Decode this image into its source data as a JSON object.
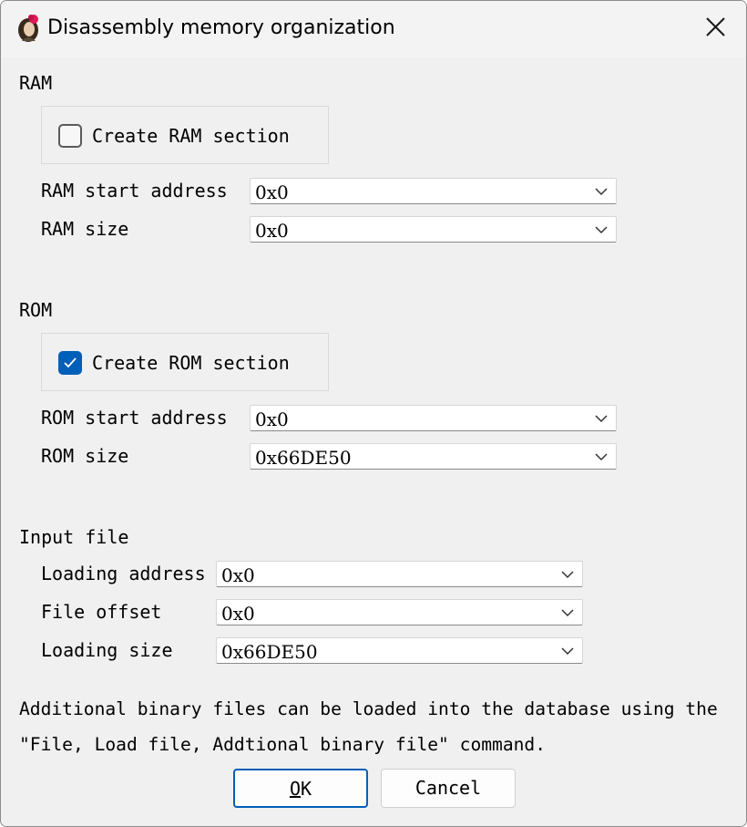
{
  "window": {
    "title": "Disassembly memory organization"
  },
  "ram": {
    "section_label": "RAM",
    "create_label": "Create RAM section",
    "create_checked": false,
    "start_label": "RAM start address",
    "start_value": "0x0",
    "size_label": "RAM size",
    "size_value": "0x0"
  },
  "rom": {
    "section_label": "ROM",
    "create_label": "Create ROM section",
    "create_checked": true,
    "start_label": "ROM start address",
    "start_value": "0x0",
    "size_label": "ROM size",
    "size_value": "0x66DE50"
  },
  "input_file": {
    "section_label": "Input file",
    "loading_address_label": "Loading address",
    "loading_address_value": "0x0",
    "file_offset_label": "File offset",
    "file_offset_value": "0x0",
    "loading_size_label": "Loading size",
    "loading_size_value": "0x66DE50"
  },
  "info": {
    "line1": "Additional binary files can be loaded into the database using the",
    "line2": "\"File, Load file, Addtional binary file\" command."
  },
  "buttons": {
    "ok_rest": "K",
    "ok_mnemonic": "O",
    "cancel_label": "Cancel"
  },
  "colors": {
    "accent": "#005fb8",
    "background": "#f0f0f0"
  },
  "icons": {
    "app": "ida-portrait-icon",
    "close": "close-icon",
    "dropdown": "chevron-down-icon",
    "check": "checkmark-icon"
  }
}
